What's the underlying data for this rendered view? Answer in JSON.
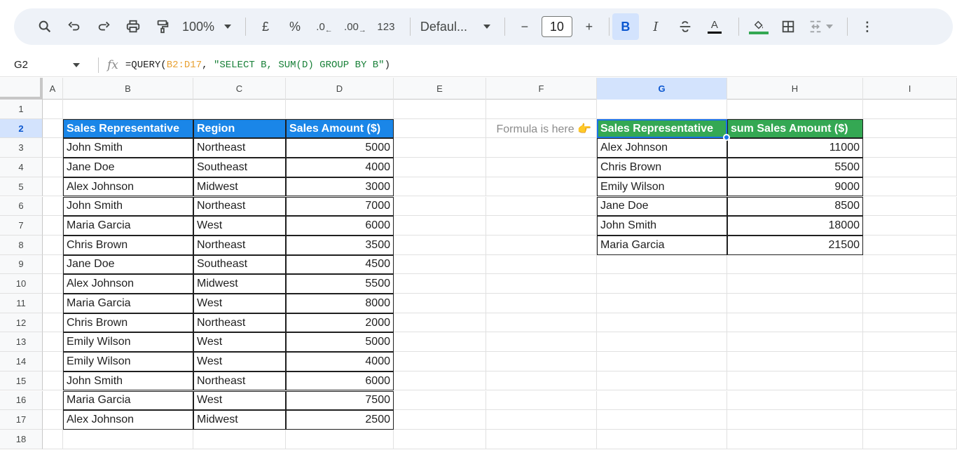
{
  "toolbar": {
    "zoom": "100%",
    "currency": "£",
    "percent": "%",
    "decrease_decimal": ".0",
    "increase_decimal": ".00",
    "format_123": "123",
    "font": "Defaul...",
    "font_size": "10",
    "minus": "−",
    "plus": "+",
    "bold": "B",
    "italic": "I",
    "text_color": "A",
    "more": "⋮"
  },
  "formula_bar": {
    "cell_ref": "G2",
    "fx": "fx",
    "formula_prefix": "=QUERY(",
    "formula_range": "B2:D17",
    "formula_mid": ", ",
    "formula_string": "\"SELECT B, SUM(D) GROUP BY B\"",
    "formula_suffix": ")"
  },
  "columns": [
    "A",
    "B",
    "C",
    "D",
    "E",
    "F",
    "G",
    "H",
    "I"
  ],
  "rows": [
    "1",
    "2",
    "3",
    "4",
    "5",
    "6",
    "7",
    "8",
    "9",
    "10",
    "11",
    "12",
    "13",
    "14",
    "15",
    "16",
    "17",
    "18"
  ],
  "source_table": {
    "headers": [
      "Sales Representative",
      "Region",
      "Sales Amount ($)"
    ],
    "rows": [
      [
        "John Smith",
        "Northeast",
        "5000"
      ],
      [
        "Jane Doe",
        "Southeast",
        "4000"
      ],
      [
        "Alex Johnson",
        "Midwest",
        "3000"
      ],
      [
        "John Smith",
        "Northeast",
        "7000"
      ],
      [
        "Maria Garcia",
        "West",
        "6000"
      ],
      [
        "Chris Brown",
        "Northeast",
        "3500"
      ],
      [
        "Jane Doe",
        "Southeast",
        "4500"
      ],
      [
        "Alex Johnson",
        "Midwest",
        "5500"
      ],
      [
        "Maria Garcia",
        "West",
        "8000"
      ],
      [
        "Chris Brown",
        "Northeast",
        "2000"
      ],
      [
        "Emily Wilson",
        "West",
        "5000"
      ],
      [
        "Emily Wilson",
        "West",
        "4000"
      ],
      [
        "John Smith",
        "Northeast",
        "6000"
      ],
      [
        "Maria Garcia",
        "West",
        "7500"
      ],
      [
        "Alex Johnson",
        "Midwest",
        "2500"
      ]
    ]
  },
  "note": "Formula is here 👉",
  "result_table": {
    "headers": [
      "Sales Representative",
      "sum Sales Amount ($)"
    ],
    "rows": [
      [
        "Alex Johnson",
        "11000"
      ],
      [
        "Chris Brown",
        "5500"
      ],
      [
        "Emily Wilson",
        "9000"
      ],
      [
        "Jane Doe",
        "8500"
      ],
      [
        "John Smith",
        "18000"
      ],
      [
        "Maria Garcia",
        "21500"
      ]
    ]
  },
  "colors": {
    "header_blue": "#1a86e8",
    "header_green": "#34a853",
    "selection": "#1a73e8"
  }
}
